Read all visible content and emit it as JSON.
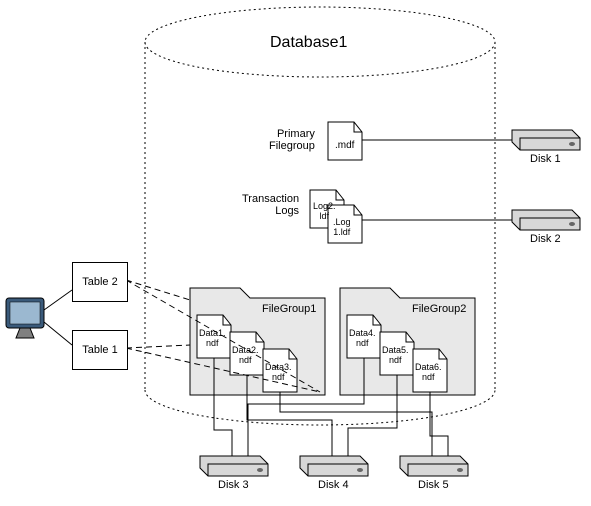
{
  "title": "Database1",
  "primary_filegroup_label": "Primary\nFilegroup",
  "transaction_logs_label": "Transaction\nLogs",
  "mdf_file": ".mdf",
  "log_files": [
    "Log2.\nldf",
    ".Log\n1.ldf"
  ],
  "tables": [
    "Table\n2",
    "Table\n1"
  ],
  "filegroups": [
    {
      "name": "FileGroup1",
      "files": [
        "Data1.\nndf",
        "Data2.\nndf",
        "Data3.\nndf"
      ]
    },
    {
      "name": "FileGroup2",
      "files": [
        "Data4.\nndf",
        "Data5.\nndf",
        "Data6.\nndf"
      ]
    }
  ],
  "disks": [
    "Disk 1",
    "Disk 2",
    "Disk 3",
    "Disk 4",
    "Disk 5"
  ]
}
